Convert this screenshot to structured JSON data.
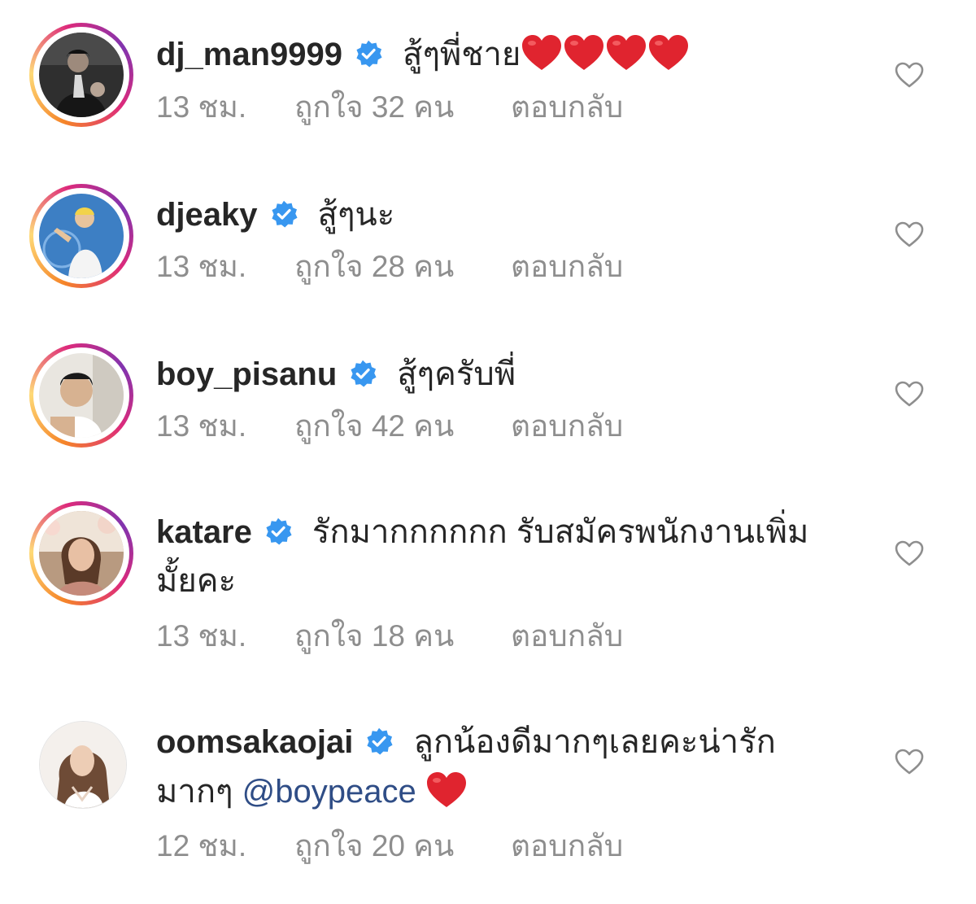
{
  "comments": [
    {
      "username": "dj_man9999",
      "line1": "สู้ๆพี่ชาย",
      "hearts": 4,
      "time": "13 ชม.",
      "likes": "ถูกใจ 32 คน",
      "reply": "ตอบกลับ"
    },
    {
      "username": "djeaky",
      "line1": "สู้ๆนะ",
      "time": "13 ชม.",
      "likes": "ถูกใจ 28 คน",
      "reply": "ตอบกลับ"
    },
    {
      "username": "boy_pisanu",
      "line1": "สู้ๆครับพี่",
      "time": "13 ชม.",
      "likes": "ถูกใจ 42 คน",
      "reply": "ตอบกลับ"
    },
    {
      "username": "katare",
      "line1": "รักมากกกกกก รับสมัครพนักงานเพิ่ม",
      "line2": "มั้ยคะ",
      "time": "13 ชม.",
      "likes": "ถูกใจ 18 คน",
      "reply": "ตอบกลับ"
    },
    {
      "username": "oomsakaojai",
      "line1": "ลูกน้องดีมากๆเลยคะน่ารัก",
      "line2": "มากๆ",
      "mention": "@boypeace",
      "hearts": 1,
      "time": "12 ชม.",
      "likes": "ถูกใจ 20 คน",
      "reply": "ตอบกลับ"
    }
  ],
  "icons": {
    "verified_badge": "verified-badge-icon",
    "like": "heart-outline-icon",
    "emoji": "red-heart-emoji"
  },
  "colors": {
    "verified": "#3897f0",
    "meta_text": "#8e8e8e",
    "username": "#262626",
    "mention": "#2f4d86",
    "heart_emoji": "#e0242f"
  }
}
